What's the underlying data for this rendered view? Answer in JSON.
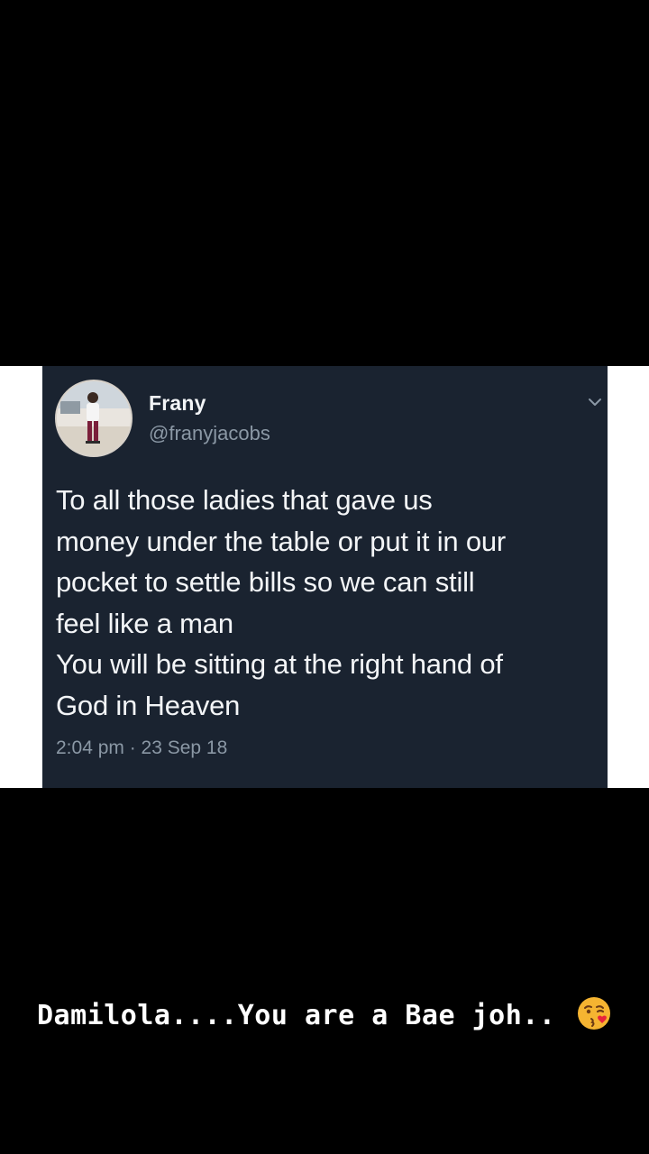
{
  "tweet": {
    "display_name": "Frany",
    "handle": "@franyjacobs",
    "text_lines": [
      "To all those ladies that gave us",
      "money under the table or put it in our",
      "pocket to settle bills so we can still",
      "feel like a man",
      "You will be sitting at the right hand of",
      "God in Heaven"
    ],
    "timestamp": "2:04 pm · 23 Sep 18"
  },
  "caption": {
    "text": "Damilola....You are a Bae joh..",
    "emoji": "face-blowing-a-kiss"
  },
  "colors": {
    "background": "#000000",
    "card": "#1a2330",
    "text": "#f3f5f7",
    "muted": "#8b98a5"
  }
}
